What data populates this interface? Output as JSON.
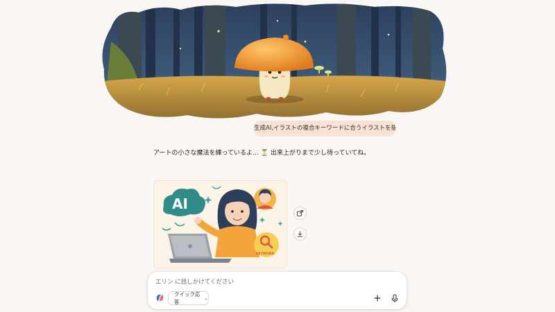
{
  "chat": {
    "user_message": "生成AI,イラストの複合キーワードに合うイラストを描いて。",
    "assistant_message": "アートの小さな魔法を練っているよ… ⏳ 出来上がりまで少し待っていてね。",
    "generated_image_text": {
      "ai_label": "AI",
      "keyword_label": "KEYWORD"
    }
  },
  "actions": {
    "share_icon": "share-icon",
    "download_icon": "download-icon"
  },
  "composer": {
    "placeholder": "エリン に話しかけてください",
    "quick_reply_label": "クイック応答",
    "plus_icon": "plus-icon",
    "mic_icon": "microphone-icon"
  },
  "colors": {
    "background": "#faf6f3",
    "user_bubble": "#f7e2d3",
    "accent_orange": "#f3a53a"
  }
}
